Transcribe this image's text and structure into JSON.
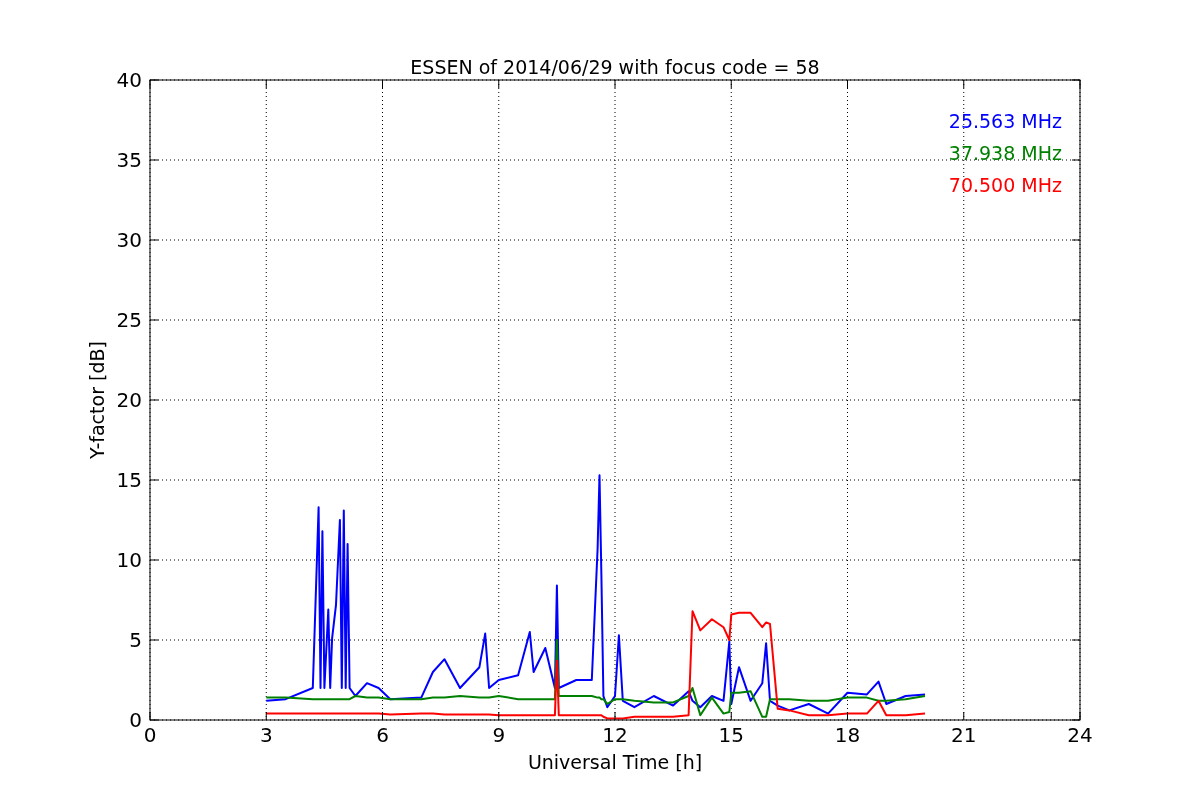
{
  "chart_data": {
    "type": "line",
    "title": "ESSEN of 2014/06/29 with focus code = 58",
    "xlabel": "Universal Time [h]",
    "ylabel": "Y-factor [dB]",
    "x": [
      3,
      3.5,
      4.2,
      4.35,
      4.4,
      4.45,
      4.5,
      4.6,
      4.65,
      4.7,
      4.8,
      4.9,
      4.95,
      5.0,
      5.05,
      5.1,
      5.15,
      5.3,
      5.6,
      5.9,
      6.2,
      7.0,
      7.3,
      7.6,
      8.0,
      8.5,
      8.65,
      8.75,
      9.0,
      9.5,
      9.8,
      9.9,
      10.2,
      10.45,
      10.5,
      10.55,
      11.0,
      11.4,
      11.55,
      11.6,
      11.65,
      11.7,
      11.8,
      12.0,
      12.1,
      12.2,
      12.5,
      13.0,
      13.5,
      13.9,
      14.0,
      14.2,
      14.5,
      14.8,
      14.95,
      15.0,
      15.2,
      15.5,
      15.8,
      15.9,
      16.0,
      16.2,
      16.5,
      17.0,
      17.5,
      18.0,
      18.5,
      18.8,
      19.0,
      19.5,
      20.0
    ],
    "series": [
      {
        "name": "25.563 MHz",
        "color": "#0000ff",
        "values": [
          1.2,
          1.3,
          2,
          13.3,
          2,
          11.8,
          2,
          6.9,
          2,
          5.1,
          7.2,
          12.5,
          2,
          13.1,
          2,
          11,
          2,
          1.5,
          2.3,
          2,
          1.3,
          1.4,
          3,
          3.8,
          2,
          3.3,
          5.4,
          2,
          2.5,
          2.8,
          5.5,
          3,
          4.5,
          2,
          8.4,
          2,
          2.5,
          2.5,
          10.7,
          15.3,
          9,
          1.5,
          0.8,
          1.5,
          5.3,
          1.2,
          0.8,
          1.5,
          0.9,
          1.8,
          1.2,
          0.8,
          1.5,
          1.2,
          4.9,
          1,
          3.3,
          1.2,
          2.3,
          4.8,
          1.2,
          0.9,
          0.6,
          1,
          0.4,
          1.7,
          1.6,
          2.4,
          1,
          1.5,
          1.6
        ]
      },
      {
        "name": "37.938 MHz",
        "color": "#008000",
        "values": [
          1.4,
          1.4,
          1.3,
          1.3,
          1.3,
          1.3,
          1.3,
          1.3,
          1.3,
          1.3,
          1.3,
          1.3,
          1.3,
          1.3,
          1.3,
          1.3,
          1.3,
          1.5,
          1.4,
          1.4,
          1.3,
          1.3,
          1.4,
          1.4,
          1.5,
          1.4,
          1.4,
          1.4,
          1.5,
          1.3,
          1.3,
          1.3,
          1.3,
          1.3,
          5,
          1.5,
          1.5,
          1.5,
          1.4,
          1.4,
          1.3,
          1.3,
          1.0,
          1.3,
          1.3,
          1.3,
          1.2,
          1.1,
          1.1,
          1.5,
          2,
          0.3,
          1.4,
          0.4,
          0.5,
          1.7,
          1.7,
          1.8,
          0.2,
          0.2,
          1.3,
          1.3,
          1.3,
          1.2,
          1.2,
          1.4,
          1.4,
          1.2,
          1.2,
          1.3,
          1.5
        ]
      },
      {
        "name": "70.500 MHz",
        "color": "#ff0000",
        "values": [
          0.4,
          0.4,
          0.4,
          0.4,
          0.4,
          0.4,
          0.4,
          0.4,
          0.4,
          0.4,
          0.4,
          0.4,
          0.4,
          0.4,
          0.4,
          0.4,
          0.4,
          0.4,
          0.4,
          0.4,
          0.35,
          0.4,
          0.4,
          0.35,
          0.35,
          0.35,
          0.35,
          0.35,
          0.3,
          0.3,
          0.3,
          0.3,
          0.3,
          0.3,
          3.7,
          0.3,
          0.3,
          0.3,
          0.3,
          0.3,
          0.3,
          0.2,
          0.1,
          0.1,
          0.1,
          0.1,
          0.2,
          0.2,
          0.2,
          0.3,
          6.8,
          5.6,
          6.3,
          5.8,
          5,
          6.6,
          6.7,
          6.7,
          5.8,
          6.1,
          6.0,
          0.7,
          0.6,
          0.3,
          0.3,
          0.4,
          0.4,
          1.2,
          0.3,
          0.3,
          0.4
        ]
      }
    ],
    "grid": true,
    "xlim": [
      0,
      24
    ],
    "ylim": [
      0,
      40
    ],
    "xticks": [
      0,
      3,
      6,
      9,
      12,
      15,
      18,
      21,
      24
    ],
    "yticks": [
      0,
      5,
      10,
      15,
      20,
      25,
      30,
      35,
      40
    ]
  }
}
